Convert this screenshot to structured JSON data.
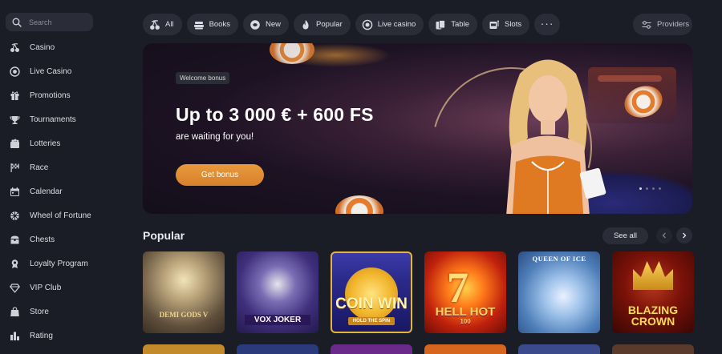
{
  "sidebar": {
    "search_placeholder": "Search",
    "items": [
      {
        "label": "Casino",
        "icon": "cherries-icon"
      },
      {
        "label": "Live Casino",
        "icon": "chip-icon"
      },
      {
        "label": "Promotions",
        "icon": "gift-icon"
      },
      {
        "label": "Tournaments",
        "icon": "trophy-icon"
      },
      {
        "label": "Lotteries",
        "icon": "lottery-icon"
      },
      {
        "label": "Race",
        "icon": "flag-icon"
      },
      {
        "label": "Calendar",
        "icon": "calendar-icon"
      },
      {
        "label": "Wheel of Fortune",
        "icon": "wheel-icon"
      },
      {
        "label": "Chests",
        "icon": "chest-icon"
      },
      {
        "label": "Loyalty Program",
        "icon": "medal-icon"
      },
      {
        "label": "VIP Club",
        "icon": "diamond-icon"
      },
      {
        "label": "Store",
        "icon": "bag-icon"
      },
      {
        "label": "Rating",
        "icon": "bar-chart-icon"
      }
    ]
  },
  "filters": [
    {
      "label": "All",
      "icon": "cherries-icon"
    },
    {
      "label": "Books",
      "icon": "books-icon"
    },
    {
      "label": "New",
      "icon": "new-icon"
    },
    {
      "label": "Popular",
      "icon": "fire-icon"
    },
    {
      "label": "Live casino",
      "icon": "chip-icon"
    },
    {
      "label": "Table",
      "icon": "cards-icon"
    },
    {
      "label": "Slots",
      "icon": "slots-icon"
    }
  ],
  "more_label": "···",
  "providers_label": "Providers",
  "banner": {
    "badge": "Welcome bonus",
    "headline": "Up to 3 000 € + 600 FS",
    "subtitle": "are waiting for you!",
    "cta": "Get bonus",
    "slides": 4,
    "active_slide": 1
  },
  "popular": {
    "title": "Popular",
    "see_all": "See all",
    "games": [
      {
        "title": "DEMI GODS V"
      },
      {
        "title": "VOX JOKER"
      },
      {
        "title": "COIN WIN",
        "tag": "HOLD THE SPIN"
      },
      {
        "title": "HELL HOT",
        "sub": "100"
      },
      {
        "title": "QUEEN OF ICE"
      },
      {
        "title": "BLAZING CROWN"
      }
    ]
  },
  "colors": {
    "background": "#1b1d26",
    "surface": "#2a2c37",
    "accent": "#e08d35"
  }
}
